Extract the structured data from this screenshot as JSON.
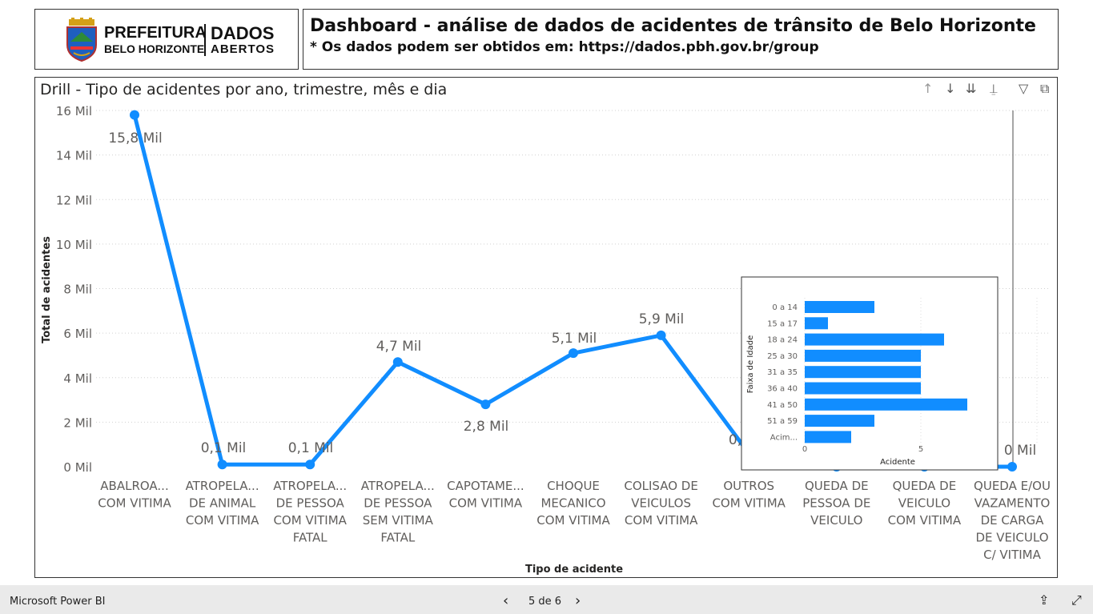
{
  "logo": {
    "line1": "PREFEITURA",
    "line2": "BELO HORIZONTE",
    "line3": "DADOS",
    "line4": "ABERTOS"
  },
  "header": {
    "title": "Dashboard - análise de dados de acidentes de trânsito de Belo Horizonte",
    "subtitle": "* Os dados podem ser obtidos em: https://dados.pbh.gov.br/group"
  },
  "visual": {
    "title": "Drill - Tipo de acidentes por ano, trimestre, mês e dia",
    "toolbar": [
      "drill-up-icon",
      "drill-down-icon",
      "expand-all-icon",
      "expand-hierarchy-icon",
      "filter-icon",
      "focus-mode-icon"
    ]
  },
  "chart_data": [
    {
      "type": "line",
      "xlabel": "Tipo de acidente",
      "ylabel": "Total de acidentes",
      "ylim": [
        0,
        16
      ],
      "yticks": [
        "0 Mil",
        "2 Mil",
        "4 Mil",
        "6 Mil",
        "8 Mil",
        "10 Mil",
        "12 Mil",
        "14 Mil",
        "16 Mil"
      ],
      "categories": [
        "ABALROA... COM VITIMA",
        "ATROPELA... DE ANIMAL COM VITIMA",
        "ATROPELA... DE PESSOA COM VITIMA FATAL",
        "ATROPELA... DE PESSOA SEM VITIMA FATAL",
        "CAPOTAME... COM VITIMA",
        "CHOQUE MECANICO COM VITIMA",
        "COLISAO DE VEICULOS COM VITIMA",
        "OUTROS COM VITIMA",
        "QUEDA DE PESSOA DE VEICULO",
        "QUEDA DE VEICULO COM VITIMA",
        "QUEDA E/OU VAZAMENTO DE CARGA DE VEICULO C/ VITIMA"
      ],
      "values": [
        15.8,
        0.1,
        0.1,
        4.7,
        2.8,
        5.1,
        5.9,
        0.6,
        0.0,
        0.0,
        0.0
      ],
      "data_labels": [
        "15,8 Mil",
        "0,1 Mil",
        "0,1 Mil",
        "4,7 Mil",
        "2,8 Mil",
        "5,1 Mil",
        "5,9 Mil",
        "0,",
        "",
        "",
        "0 Mil"
      ],
      "grid": true,
      "color": "#118DFF"
    },
    {
      "type": "bar",
      "orientation": "horizontal",
      "xlabel": "Acidente",
      "ylabel": "Faixa de Idade",
      "categories": [
        "0 a 14",
        "15 a 17",
        "18 a 24",
        "25 a 30",
        "31 a 35",
        "36 a 40",
        "41 a 50",
        "51 a 59",
        "Acim..."
      ],
      "values": [
        3,
        1,
        6,
        5,
        5,
        5,
        7,
        3,
        2
      ],
      "xticks": [
        "0",
        "5"
      ],
      "xlim": [
        0,
        10
      ],
      "color": "#118DFF"
    }
  ],
  "bottom_bar": {
    "app_name": "Microsoft Power BI",
    "page_indicator": "5 de 6"
  }
}
